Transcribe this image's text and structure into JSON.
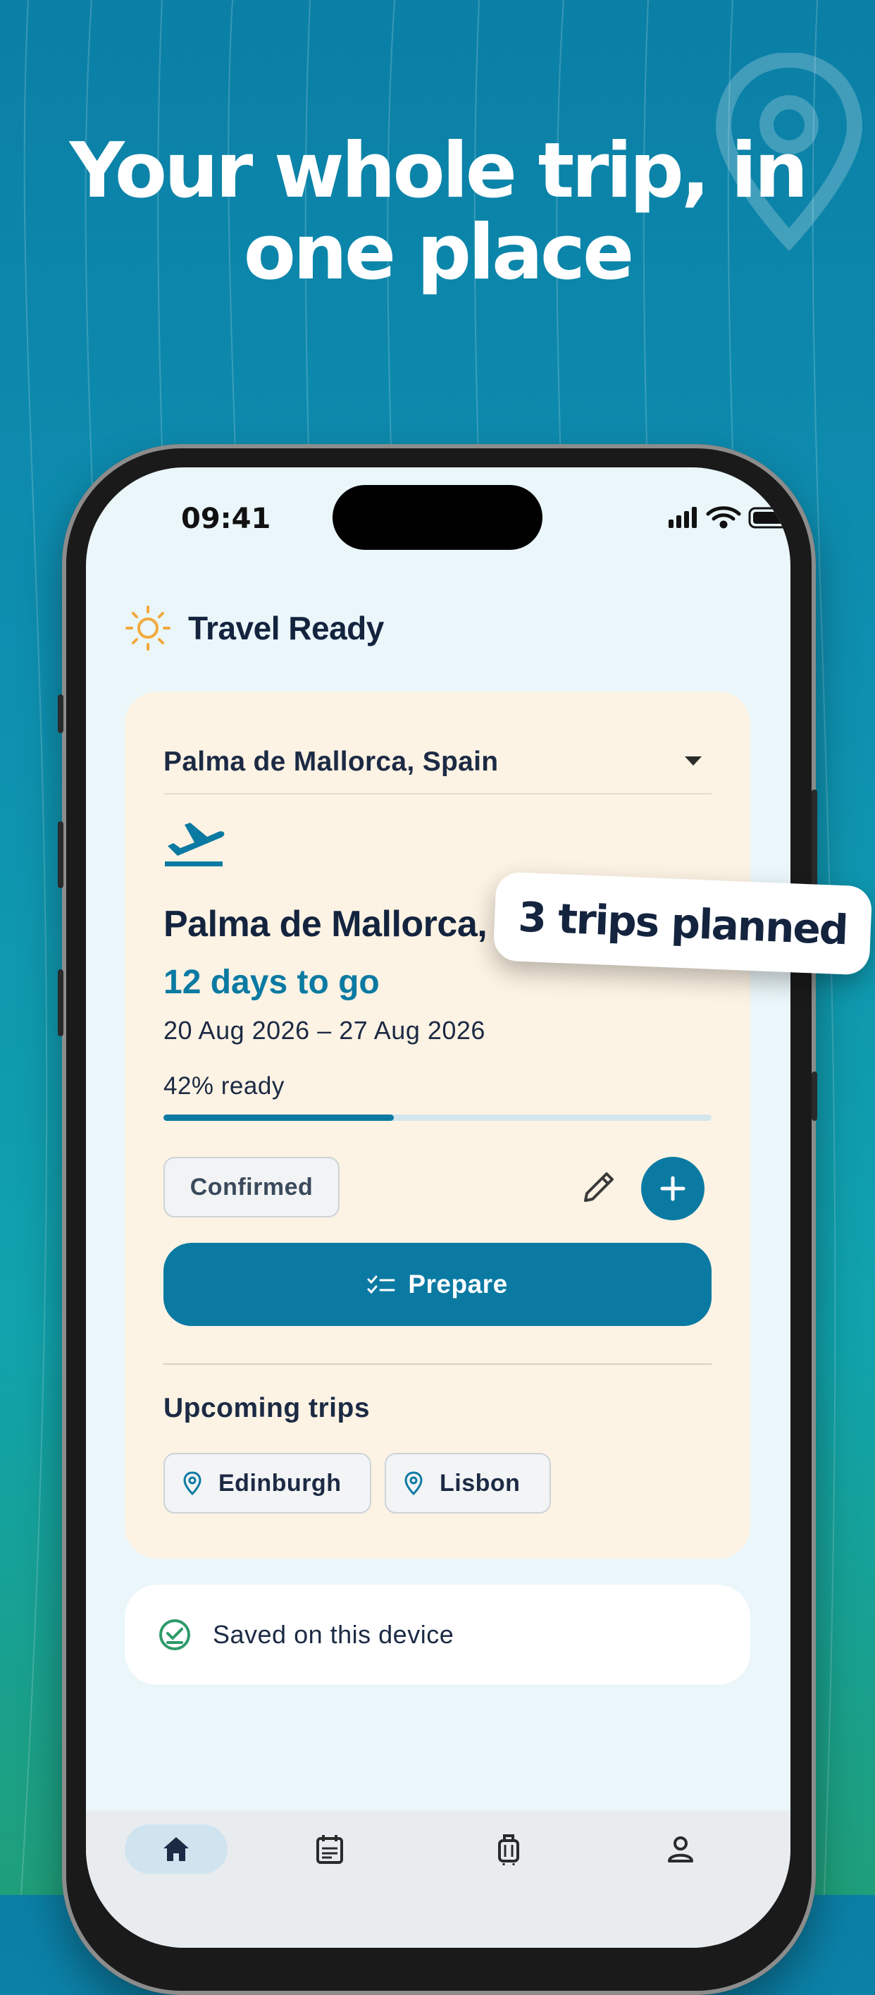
{
  "hero": {
    "headline_line1": "Your whole trip, in",
    "headline_line2": "one place"
  },
  "status_bar": {
    "time": "09:41"
  },
  "app": {
    "title": "Travel Ready"
  },
  "trip_card": {
    "destination_select": "Palma de Mallorca, Spain",
    "trip_title": "Palma de Mallorca, ",
    "countdown": "12 days to go",
    "dates": "20 Aug 2026 – 27 Aug 2026",
    "progress_label": "42% ready",
    "progress_fraction": 0.42,
    "status_badge": "Confirmed",
    "prepare_label": "Prepare",
    "upcoming_title": "Upcoming trips",
    "upcoming": [
      {
        "label": "Edinburgh"
      },
      {
        "label": "Lisbon"
      }
    ]
  },
  "saved": {
    "label": "Saved on this device"
  },
  "sticker": {
    "label": "3 trips planned"
  },
  "tabs": [
    {
      "icon": "home-icon",
      "active": true
    },
    {
      "icon": "calendar-icon",
      "active": false
    },
    {
      "icon": "luggage-icon",
      "active": false
    },
    {
      "icon": "profile-icon",
      "active": false
    }
  ],
  "colors": {
    "accent": "#0b7aa3",
    "card": "#fdf3e4",
    "sun": "#f2a93b",
    "success": "#2e9a6a"
  }
}
